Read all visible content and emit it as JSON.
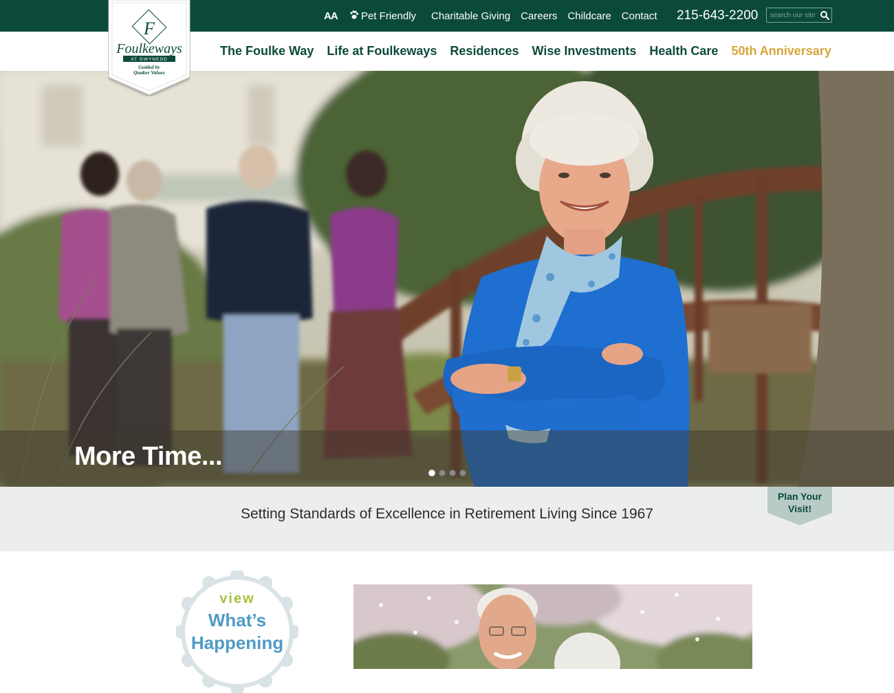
{
  "utility": {
    "font_size_label": "AA",
    "pet_friendly": "Pet Friendly",
    "links": [
      "Charitable Giving",
      "Careers",
      "Childcare",
      "Contact"
    ],
    "phone": "215-643-2200",
    "search_placeholder": "search our site"
  },
  "logo": {
    "monogram": "F",
    "name": "Foulkeways",
    "subname": "AT GWYNEDD",
    "tagline_line1": "Guided by",
    "tagline_line2": "Quaker Values"
  },
  "nav": {
    "items": [
      "The Foulke Way",
      "Life at Foulkeways",
      "Residences",
      "Wise Investments",
      "Health Care",
      "50th Anniversary"
    ]
  },
  "hero": {
    "caption": "More Time...",
    "slide_count": 4,
    "active_slide": 1
  },
  "band": {
    "tagline": "Setting Standards of Excellence in Retirement Living Since 1967",
    "plan_line1": "Plan Your",
    "plan_line2": "Visit!"
  },
  "badge": {
    "view": "view",
    "line1": "What’s",
    "line2": "Happening"
  },
  "colors": {
    "brand_green": "#0b4a3a",
    "gold": "#d7a63a",
    "band_gray": "#eceeed",
    "badge_green": "#a5c23e",
    "badge_blue": "#4f9bc6"
  }
}
